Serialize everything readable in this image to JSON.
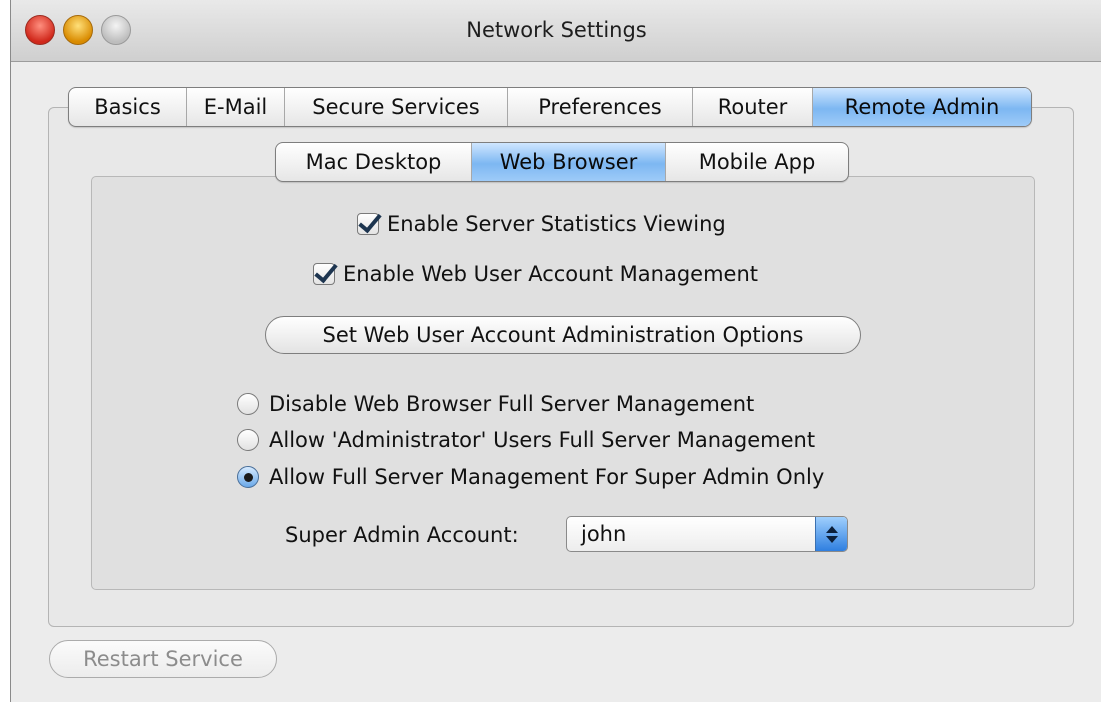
{
  "window": {
    "title": "Network Settings",
    "traffic_lights": [
      "close",
      "minimize",
      "zoom"
    ]
  },
  "main_tabs": {
    "items": [
      {
        "label": "Basics",
        "active": false
      },
      {
        "label": "E-Mail",
        "active": false
      },
      {
        "label": "Secure Services",
        "active": false
      },
      {
        "label": "Preferences",
        "active": false
      },
      {
        "label": "Router",
        "active": false
      },
      {
        "label": "Remote Admin",
        "active": true
      }
    ]
  },
  "sub_tabs": {
    "items": [
      {
        "label": "Mac Desktop",
        "active": false
      },
      {
        "label": "Web Browser",
        "active": true
      },
      {
        "label": "Mobile App",
        "active": false
      }
    ]
  },
  "options": {
    "enable_stats": {
      "label": "Enable Server Statistics Viewing",
      "checked": true
    },
    "enable_account_mgmt": {
      "label": "Enable Web User Account Management",
      "checked": true
    },
    "set_options_button": "Set Web User Account Administration Options"
  },
  "management": {
    "radios": [
      {
        "label": "Disable Web Browser Full Server Management",
        "selected": false
      },
      {
        "label": "Allow 'Administrator' Users Full Server Management",
        "selected": false
      },
      {
        "label": "Allow Full Server Management For Super Admin Only",
        "selected": true
      }
    ],
    "super_admin_label": "Super Admin Account:",
    "super_admin_value": "john"
  },
  "footer": {
    "restart_button": "Restart Service",
    "restart_enabled": false
  },
  "colors": {
    "accent": "#7db7f2",
    "window_bg": "#ececec",
    "disabled_text": "#8c8c8c"
  }
}
